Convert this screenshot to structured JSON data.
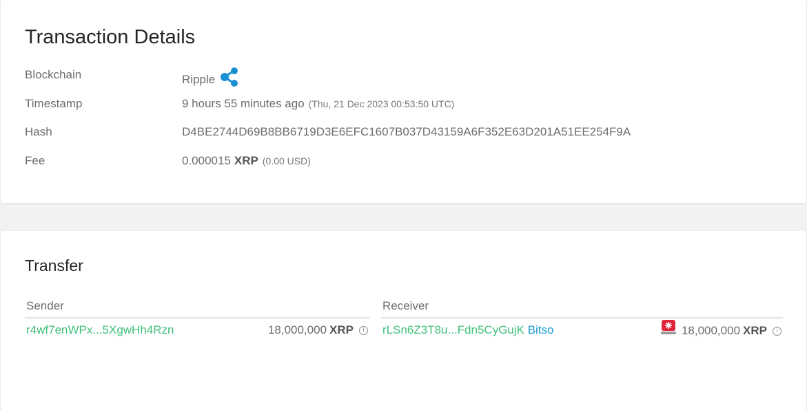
{
  "details": {
    "title": "Transaction Details",
    "blockchain_label": "Blockchain",
    "blockchain_value": "Ripple",
    "blockchain_icon": "ripple-logo-icon",
    "timestamp_label": "Timestamp",
    "timestamp_relative": "9 hours 55 minutes ago",
    "timestamp_absolute": "(Thu, 21 Dec 2023 00:53:50 UTC)",
    "hash_label": "Hash",
    "hash_value": "D4BE2744D69B8BB6719D3E6EFC1607B037D43159A6F352E63D201A51EE254F9A",
    "fee_label": "Fee",
    "fee_amount": "0.000015",
    "fee_unit": "XRP",
    "fee_usd": "(0.00 USD)"
  },
  "transfer": {
    "title": "Transfer",
    "sender": {
      "header": "Sender",
      "address": "r4wf7enWPx...5XgwHh4Rzn",
      "amount": "18,000,000",
      "unit": "XRP"
    },
    "receiver": {
      "header": "Receiver",
      "address": "rLSn6Z3T8u...Fdn5CyGujK",
      "tag": "Bitso",
      "amount": "18,000,000",
      "unit": "XRP"
    }
  },
  "colors": {
    "link_green": "#3fc07a",
    "tag_blue": "#1a9ad6",
    "ripple_blue": "#1a8fd1",
    "alarm_red": "#e0253a"
  }
}
